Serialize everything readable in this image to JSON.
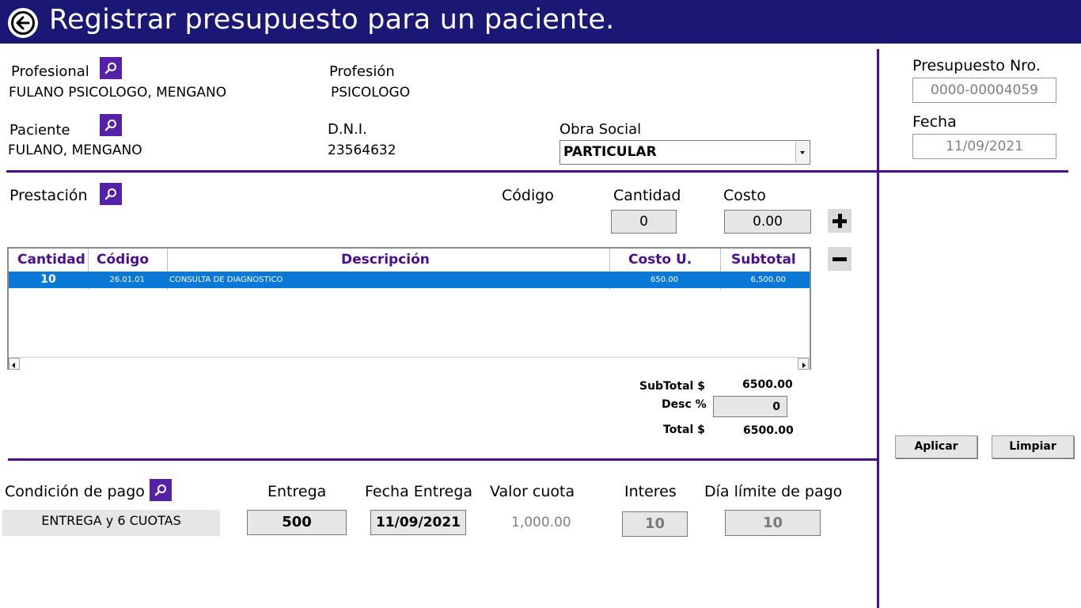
{
  "header": {
    "title": "Registrar presupuesto para un paciente."
  },
  "profesional": {
    "label": "Profesional",
    "value": "FULANO PSICOLOGO, MENGANO"
  },
  "profesion": {
    "label": "Profesión",
    "value": "PSICOLOGO"
  },
  "paciente": {
    "label": "Paciente",
    "value": "FULANO, MENGANO"
  },
  "dni": {
    "label": "D.N.I.",
    "value": "23564632"
  },
  "obra_social": {
    "label": "Obra Social",
    "value": "PARTICULAR"
  },
  "presupuesto": {
    "label": "Presupuesto Nro.",
    "value": "0000-00004059"
  },
  "fecha": {
    "label": "Fecha",
    "value": "11/09/2021"
  },
  "prestacion": {
    "label": "Prestación",
    "codigo_label": "Código",
    "cantidad_label": "Cantidad",
    "cantidad_value": "0",
    "costo_label": "Costo",
    "costo_value": "0.00"
  },
  "table": {
    "headers": [
      "Cantidad",
      "Código",
      "Descripción",
      "Costo U.",
      "Subtotal"
    ],
    "rows": [
      {
        "cantidad": "10",
        "codigo": "26.01.01",
        "descripcion": "CONSULTA DE DIAGNOSTICO",
        "costo_u": "650.00",
        "subtotal": "6,500.00"
      }
    ]
  },
  "totals": {
    "subtotal_label": "SubTotal $",
    "subtotal_value": "6500.00",
    "desc_label": "Desc %",
    "desc_value": "0",
    "total_label": "Total $",
    "total_value": "6500.00"
  },
  "actions": {
    "aplicar": "Aplicar",
    "limpiar": "Limpiar"
  },
  "pago": {
    "condicion_label": "Condición de pago",
    "condicion_value": "ENTREGA y 6 CUOTAS",
    "entrega_label": "Entrega",
    "entrega_value": "500",
    "fecha_entrega_label": "Fecha Entrega",
    "fecha_entrega_value": "11/09/2021",
    "valor_cuota_label": "Valor cuota",
    "valor_cuota_value": "1,000.00",
    "interes_label": "Interes",
    "interes_value": "10",
    "dia_limite_label": "Día límite de pago",
    "dia_limite_value": "10"
  },
  "icons": {
    "back": "back-arrow-circle-icon",
    "search": "search-icon",
    "add": "plus-icon",
    "remove": "minus-icon",
    "dropdown": "chevron-down-icon"
  },
  "colors": {
    "header_bg": "#1a1775",
    "accent": "#4b0f8c",
    "search_btn": "#5421a8",
    "selection": "#0a78d7"
  }
}
